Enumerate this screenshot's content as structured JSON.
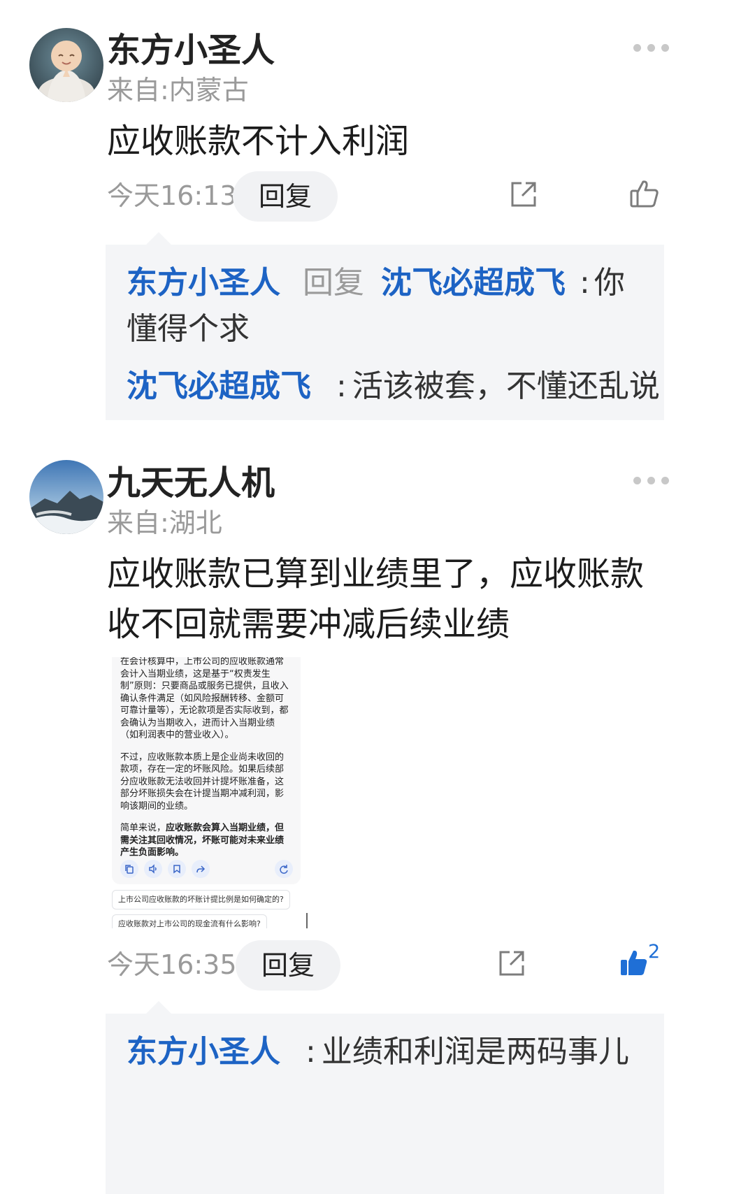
{
  "comments": [
    {
      "username": "东方小圣人",
      "location": "来自:内蒙古",
      "text": "应收账款不计入利润",
      "time": "今天16:13",
      "reply_label": "回复",
      "like_count": "",
      "replies": [
        {
          "author": "东方小圣人",
          "connector": "回复",
          "target": "沈飞必超成飞",
          "sep": ":",
          "text": "你懂得个求"
        },
        {
          "author": "沈飞必超成飞",
          "sep": ":",
          "text": "活该被套，不懂还乱说"
        }
      ]
    },
    {
      "username": "九天无人机",
      "location": "来自:湖北",
      "text": "应收账款已算到业绩里了，应收账款收不回就需要冲减后续业绩",
      "time": "今天16:35",
      "reply_label": "回复",
      "like_count": "2",
      "replies": [
        {
          "author": "东方小圣人",
          "sep": ":",
          "text": "业绩和利润是两码事儿"
        }
      ]
    }
  ],
  "screenshot": {
    "para1": "在会计核算中，上市公司的应收账款通常会计入当期业绩，这是基于“权责发生制”原则：只要商品或服务已提供，且收入确认条件满足（如风险报酬转移、金额可可靠计量等），无论款项是否实际收到，都会确认为当期收入，进而计入当期业绩（如利润表中的营业收入）。",
    "para2": "不过，应收账款本质上是企业尚未收回的款项，存在一定的坏账风险。如果后续部分应收账款无法收回并计提坏账准备，这部分坏账损失会在计提当期冲减利润，影响该期间的业绩。",
    "para3_prefix": "简单来说，",
    "para3_bold": "应收账款会算入当期业绩，但需关注其回收情况，坏账可能对未来业绩产生负面影响。",
    "suggestion1": "上市公司应收账款的坏账计提比例是如何确定的?",
    "suggestion2": "应收账款对上市公司的现金流有什么影响?"
  },
  "colors": {
    "accent_blue": "#1d63c4",
    "like_blue": "#1f6fd6",
    "meta_gray": "#9a9a9a",
    "reply_bg": "#f4f5f7"
  }
}
